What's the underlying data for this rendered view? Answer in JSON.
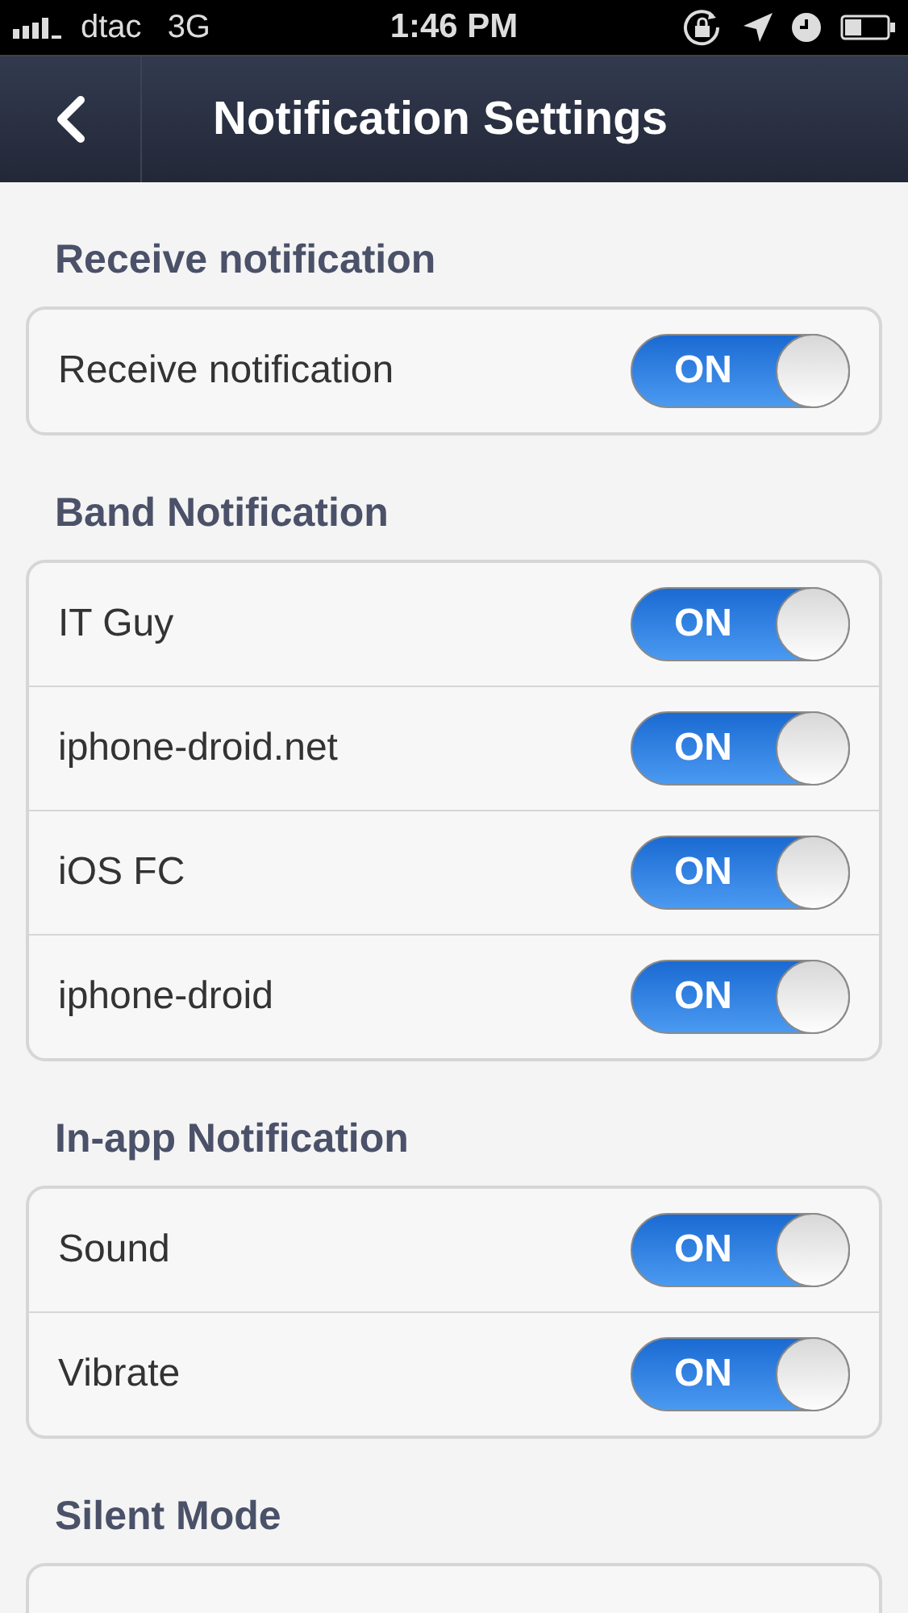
{
  "status_bar": {
    "carrier": "dtac",
    "network": "3G",
    "time": "1:46 PM"
  },
  "nav": {
    "title": "Notification Settings"
  },
  "sections": [
    {
      "title": "Receive notification",
      "items": [
        {
          "label": "Receive notification",
          "on": true,
          "switch_text": "ON"
        }
      ]
    },
    {
      "title": "Band Notification",
      "items": [
        {
          "label": "IT Guy",
          "on": true,
          "switch_text": "ON"
        },
        {
          "label": "iphone-droid.net",
          "on": true,
          "switch_text": "ON"
        },
        {
          "label": "iOS FC",
          "on": true,
          "switch_text": "ON"
        },
        {
          "label": "iphone-droid",
          "on": true,
          "switch_text": "ON"
        }
      ]
    },
    {
      "title": "In-app Notification",
      "items": [
        {
          "label": "Sound",
          "on": true,
          "switch_text": "ON"
        },
        {
          "label": "Vibrate",
          "on": true,
          "switch_text": "ON"
        }
      ]
    },
    {
      "title": "Silent Mode"
    }
  ]
}
